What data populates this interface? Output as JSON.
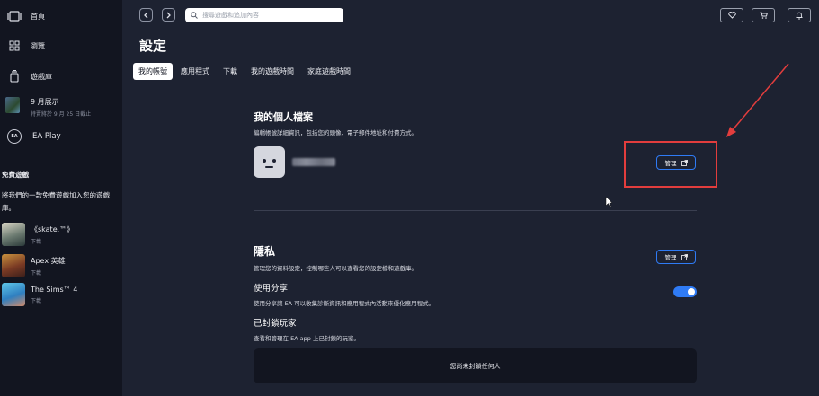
{
  "sidebar": {
    "home": "首頁",
    "browse": "瀏覽",
    "library": "遊戲庫",
    "promo": {
      "title": "9 月展示",
      "subtitle": "特賣將於 9 月 25 日截止"
    },
    "ea_play": {
      "logo": "EA",
      "label": "EA Play"
    },
    "free_games_heading": "免費遊戲",
    "free_games_desc": "將我們的一款免費遊戲加入您的遊戲庫。",
    "games": [
      {
        "title": "《skate.™》",
        "status": "下載"
      },
      {
        "title": "Apex 英雄",
        "status": "下載"
      },
      {
        "title": "The Sims™ 4",
        "status": "下載"
      }
    ]
  },
  "topbar": {
    "search_placeholder": "搜尋遊戲和追加內容",
    "icons": [
      "back-icon",
      "forward-icon",
      "search-icon",
      "heart-icon",
      "cart-icon",
      "bell-icon"
    ]
  },
  "page": {
    "title": "設定",
    "tabs": [
      "我的帳號",
      "應用程式",
      "下載",
      "我的遊戲時間",
      "家庭遊戲時間"
    ]
  },
  "profile": {
    "title": "我的個人檔案",
    "desc": "編輯帳號詳細資訊，包括您的頭像、電子郵件地址和付費方式。",
    "manage_label": "管理"
  },
  "privacy": {
    "title": "隱私",
    "desc": "管理您的資料設定，控制哪些人可以查看您的設定檔和遊戲庫。",
    "manage_label": "管理",
    "usage_sharing": {
      "title": "使用分享",
      "desc": "使用分享讓 EA 可以收集診斷資訊和應用程式內活動來優化應用程式。",
      "enabled": true
    },
    "blocked": {
      "title": "已封鎖玩家",
      "desc": "查看和管理在 EA app 上已封鎖的玩家。",
      "empty": "您尚未封鎖任何人"
    }
  },
  "colors": {
    "accent": "#2f7bf5",
    "highlight": "#e23d3d",
    "background": "#1d2231",
    "sidebar": "#121520"
  }
}
